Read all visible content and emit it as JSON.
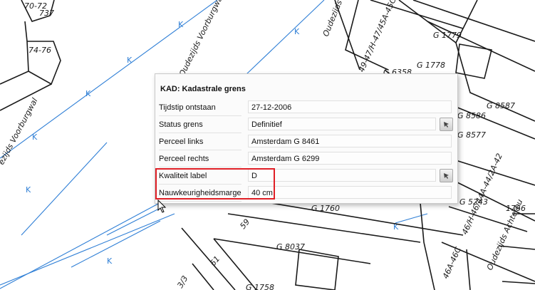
{
  "map": {
    "parcel_labels": [
      "70-72",
      "737",
      "74-76",
      "G 1779",
      "G 1778",
      "G 8586",
      "G 8587",
      "G 8577",
      "G 1760",
      "G 8037",
      "G 5243",
      "1766",
      "59",
      "61",
      "G 1758",
      "G 6358",
      "3/3"
    ],
    "address_labels": [
      "Oudezijds Voorburgwal",
      "ezijds Voorburgwal",
      "Oudezijds Vo",
      "Oudezijds Achterbu",
      "49-47/H-47/45A-45G",
      "46/H-46/44A-44/2A-42",
      "46A-46C"
    ],
    "boundary_mark": "K"
  },
  "popup": {
    "title": "KAD: Kadastrale grens",
    "rows": [
      {
        "label": "Tijdstip ontstaan",
        "value": "27-12-2006"
      },
      {
        "label": "Status grens",
        "value": "Definitief"
      },
      {
        "label": "Perceel links",
        "value": "Amsterdam G 8461"
      },
      {
        "label": "Perceel rechts",
        "value": "Amsterdam G 6299"
      },
      {
        "label": "Kwaliteit label",
        "value": "D"
      },
      {
        "label": "Nauwkeurigheidsmarge",
        "value": "40 cm"
      }
    ]
  },
  "colors": {
    "water_line": "#2f7fd6",
    "parcel_line": "#1a1a1a",
    "highlight": "#e01f26"
  },
  "icons": {
    "picker": "pick-list-icon",
    "cursor": "mouse-pointer-icon"
  }
}
